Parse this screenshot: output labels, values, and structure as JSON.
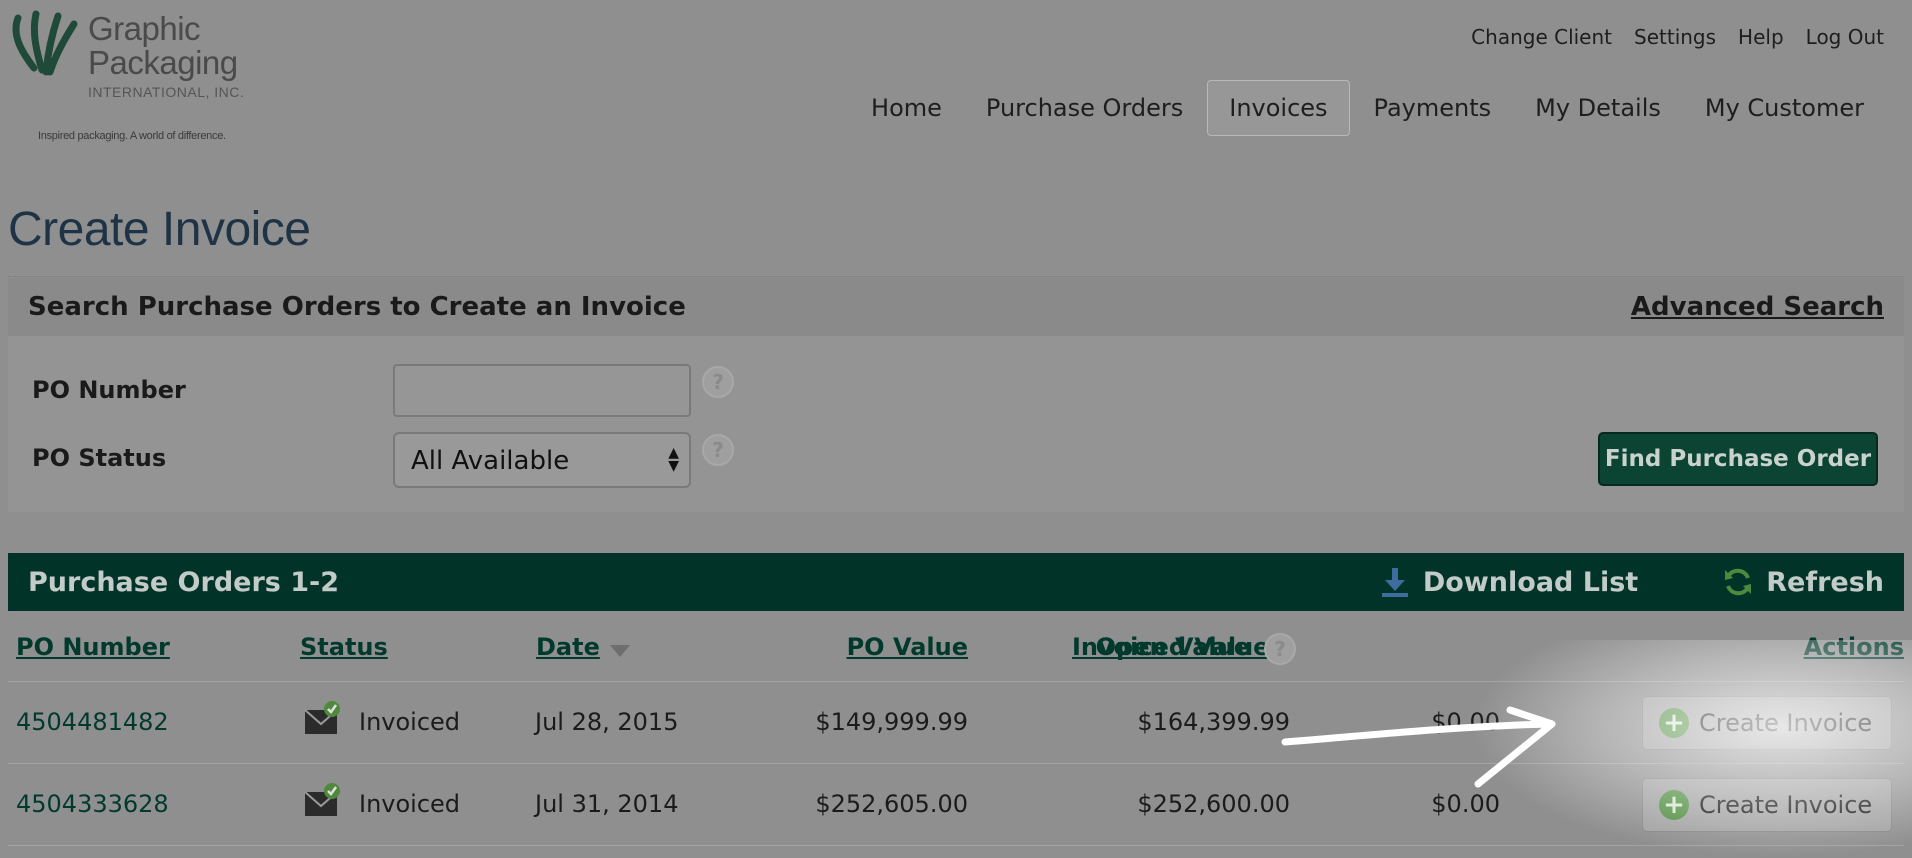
{
  "logo": {
    "line1": "Graphic",
    "line2": "Packaging",
    "line3": "INTERNATIONAL, INC.",
    "tagline": "Inspired packaging. A world of difference."
  },
  "utility_nav": [
    "Change Client",
    "Settings",
    "Help",
    "Log Out"
  ],
  "main_nav": [
    {
      "label": "Home",
      "active": false
    },
    {
      "label": "Purchase Orders",
      "active": false
    },
    {
      "label": "Invoices",
      "active": true
    },
    {
      "label": "Payments",
      "active": false
    },
    {
      "label": "My Details",
      "active": false
    },
    {
      "label": "My Customer",
      "active": false
    }
  ],
  "page_title": "Create Invoice",
  "search": {
    "title": "Search Purchase Orders to Create an Invoice",
    "advanced_link": "Advanced Search",
    "po_number_label": "PO Number",
    "po_number_value": "",
    "po_status_label": "PO Status",
    "po_status_value": "All Available",
    "find_button": "Find Purchase Order"
  },
  "results": {
    "title": "Purchase Orders 1-2",
    "download_label": "Download List",
    "refresh_label": "Refresh",
    "columns": {
      "po_number": "PO Number",
      "status": "Status",
      "date": "Date",
      "po_value": "PO Value",
      "invoiced_value": "Invoiced Value",
      "open_value": "Open Value",
      "actions": "Actions"
    },
    "rows": [
      {
        "po_number": "4504481482",
        "status": "Invoiced",
        "date": "Jul 28, 2015",
        "po_value": "$149,999.99",
        "invoiced_value": "$164,399.99",
        "open_value": "$0.00",
        "action": "Create Invoice"
      },
      {
        "po_number": "4504333628",
        "status": "Invoiced",
        "date": "Jul 31, 2014",
        "po_value": "$252,605.00",
        "invoiced_value": "$252,600.00",
        "open_value": "$0.00",
        "action": "Create Invoice"
      }
    ]
  },
  "colors": {
    "brand_green": "#013328",
    "link_green": "#013a2c",
    "title_blue": "#1f3346"
  }
}
